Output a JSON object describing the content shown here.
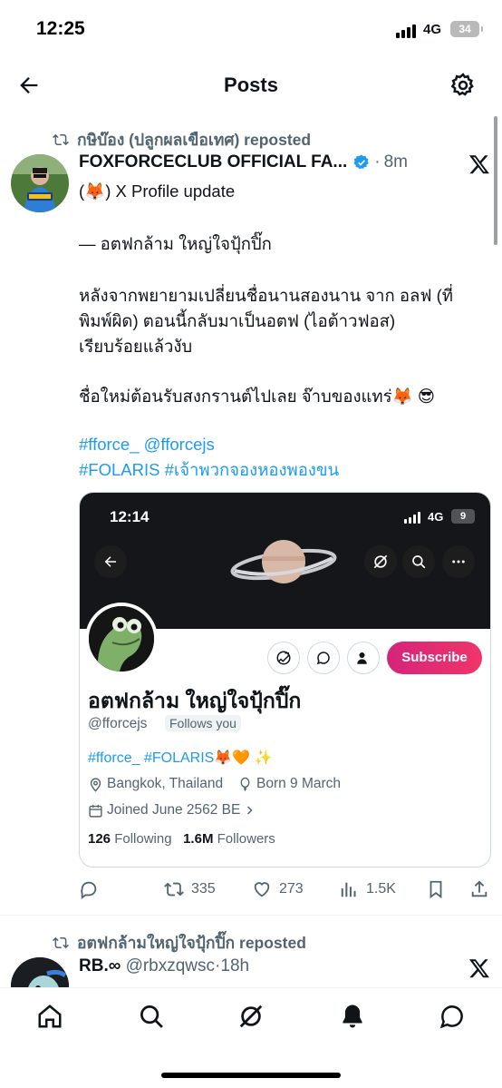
{
  "status_bar": {
    "time": "12:25",
    "network": "4G",
    "battery": "34"
  },
  "header": {
    "title": "Posts"
  },
  "post1": {
    "repost_label": "กษิบ๊อง (ปลูกผลเขือเทศ) reposted",
    "author_name": "FOXFORCECLUB OFFICIAL FA...",
    "separator": "·",
    "time": "8m",
    "lines": {
      "l1": "(🦊) X Profile update",
      "l2": "— อตฟกล้าม ใหญ่ใจปุ้กปิ๊ก",
      "l3": "หลังจากพยายามเปลี่ยนชื่อนานสองนาน จาก อลฟ (ที่",
      "l4": "พิมพ์ผิด) ตอนนี้กลับมาเป็นอตฟ (ไอต้าวฟอส)",
      "l5": "เรียบร้อยแล้วงับ",
      "l6": "ชื่อใหม่ต้อนรับสงกรานต์ไปเลย จ๊าบของแทร่🦊 😎",
      "l7": "#fforce_ @fforcejs",
      "l8": "#FOLARIS #เจ้าพวกจองหองพองขน"
    },
    "card": {
      "time": "12:14",
      "network": "4G",
      "battery": "9",
      "subscribe_label": "Subscribe",
      "profile_name": "อตฟกล้าม ใหญ่ใจปุ้กปิ๊ก",
      "handle": "@fforcejs",
      "follows_you": "Follows you",
      "bio": "#fforce_ #FOLARIS🦊🧡 ✨",
      "location": "Bangkok, Thailand",
      "born": "Born 9 March",
      "joined": "Joined June 2562 BE",
      "following_count": "126",
      "following_label": "Following",
      "followers_count": "1.6M",
      "followers_label": "Followers"
    },
    "actions": {
      "reposts": "335",
      "likes": "273",
      "views": "1.5K"
    }
  },
  "post2": {
    "repost_label": "อตฟกล้ามใหญ่ใจปุ้กปิ๊ก reposted",
    "author_name": "RB.∞",
    "handle": "@rbxzqwsc",
    "separator": "·",
    "time": "18h"
  },
  "colors": {
    "link": "#1d9bf0",
    "muted": "#536471",
    "verified": "#1d9bf0",
    "subscribe": "#e0245e"
  },
  "icons": [
    "back-arrow-icon",
    "gear-icon",
    "repost-icon",
    "verified-badge-icon",
    "x-logo-icon",
    "reply-icon",
    "heart-icon",
    "views-icon",
    "bookmark-icon",
    "share-icon",
    "home-icon",
    "search-icon",
    "grok-icon",
    "notifications-icon",
    "messages-icon"
  ]
}
